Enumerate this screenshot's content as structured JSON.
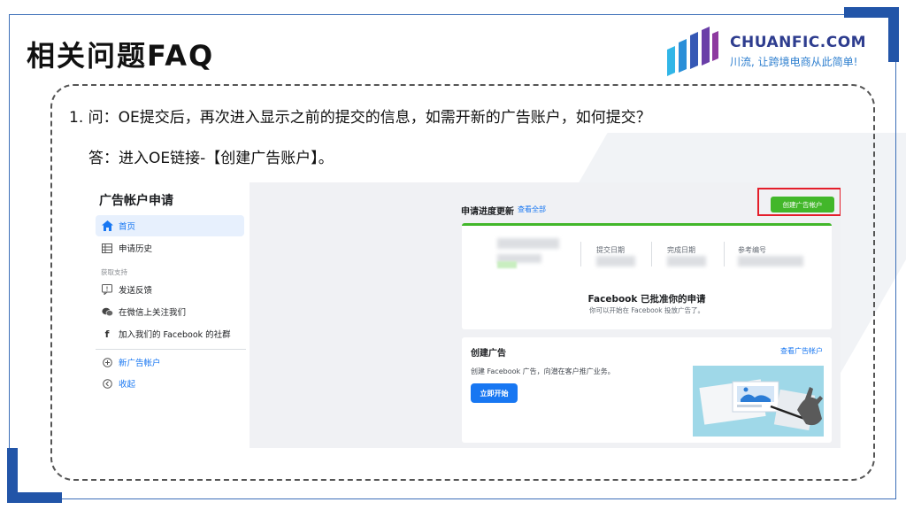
{
  "slide": {
    "title": "相关问题FAQ",
    "logo": {
      "brand": "CHUANFIC.COM",
      "tagline": "川流, 让跨境电商从此简单!"
    },
    "question": "1. 问：OE提交后，再次进入显示之前的提交的信息，如需开新的广告账户，如何提交？",
    "answer": "答：进入OE链接-【创建广告账户】。"
  },
  "screenshot": {
    "sidebar": {
      "title": "广告帐户申请",
      "items": [
        {
          "label": "首页",
          "icon": "home-icon"
        },
        {
          "label": "申请历史",
          "icon": "table-icon"
        }
      ],
      "support_label": "获取支持",
      "support_items": [
        {
          "label": "发送反馈",
          "icon": "feedback-icon"
        },
        {
          "label": "在微信上关注我们",
          "icon": "wechat-icon"
        },
        {
          "label": "加入我们的 Facebook 的社群",
          "icon": "facebook-icon"
        }
      ],
      "actions": [
        {
          "label": "新广告帐户",
          "icon": "plus-circle-icon"
        },
        {
          "label": "收起",
          "icon": "collapse-icon"
        }
      ]
    },
    "progress": {
      "title": "申请进度更新",
      "view_all": "查看全部",
      "columns": [
        "提交日期",
        "完成日期",
        "参考编号"
      ],
      "status_title": "Facebook 已批准你的申请",
      "status_sub": "你可以开始在 Facebook 投放广告了。"
    },
    "create_button": "创建广告帐户",
    "create_ad": {
      "title": "创建广告",
      "view_accounts": "查看广告帐户",
      "desc": "创建 Facebook 广告，向潜在客户推广业务。",
      "start": "立即开始"
    },
    "colors": {
      "fb_blue": "#1877f2",
      "green": "#42b72a",
      "highlight": "#e41e2a",
      "brand": "#2255a8"
    }
  }
}
